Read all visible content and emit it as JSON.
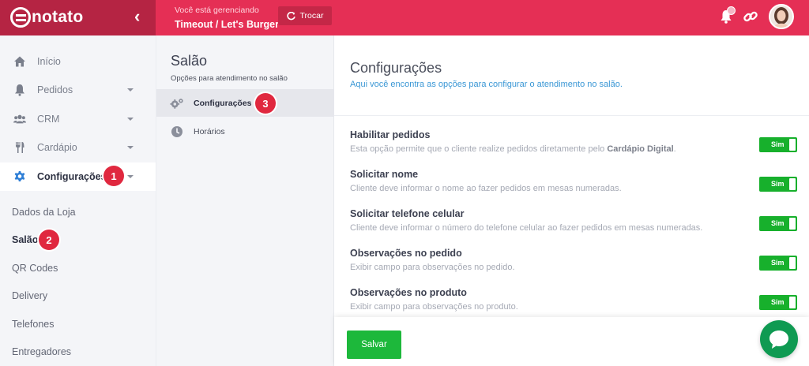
{
  "brand": {
    "name": "notato"
  },
  "topbar": {
    "managing_label": "Você está gerenciando",
    "store_name": "Timeout / Let's Burger",
    "swap_label": "Trocar",
    "notification_icon": "bell-icon",
    "link_icon": "link-icon"
  },
  "sidebar": {
    "items": [
      {
        "label": "Início",
        "icon": "home-icon"
      },
      {
        "label": "Pedidos",
        "icon": "bell-icon"
      },
      {
        "label": "CRM",
        "icon": "users-icon"
      },
      {
        "label": "Cardápio",
        "icon": "cutlery-icon"
      },
      {
        "label": "Configurações",
        "icon": "gear-icon"
      }
    ],
    "sub_items": [
      "Dados da Loja",
      "Salão",
      "QR Codes",
      "Delivery",
      "Telefones",
      "Entregadores"
    ],
    "steps": [
      "1",
      "2",
      "3"
    ]
  },
  "midpanel": {
    "title": "Salão",
    "subtitle": "Opções para atendimento no salão",
    "items": [
      {
        "label": "Configurações",
        "icon": "gears-icon"
      },
      {
        "label": "Horários",
        "icon": "clock-icon"
      }
    ]
  },
  "main": {
    "title": "Configurações",
    "description": "Aqui você encontra as opções para configurar o atendimento no salão.",
    "options": [
      {
        "title": "Habilitar pedidos",
        "desc_before": "Esta opção permite que o cliente realize pedidos diretamente pelo ",
        "desc_bold": "Cardápio Digital",
        "desc_after": ".",
        "toggle": "Sim"
      },
      {
        "title": "Solicitar nome",
        "desc": "Cliente deve informar o nome ao fazer pedidos em mesas numeradas.",
        "toggle": "Sim"
      },
      {
        "title": "Solicitar telefone celular",
        "desc": "Cliente deve informar o número do telefone celular ao fazer pedidos em mesas numeradas.",
        "toggle": "Sim"
      },
      {
        "title": "Observações no pedido",
        "desc": "Exibir campo para observações no pedido.",
        "toggle": "Sim"
      },
      {
        "title": "Observações no produto",
        "desc": "Exibir campo para observações no produto.",
        "toggle": "Sim"
      }
    ],
    "save_label": "Salvar"
  },
  "colors": {
    "brand": "#e52f55",
    "brand_dark": "#b52443",
    "toggle_on": "#17b02c",
    "save": "#1db83b",
    "link": "#3a97d5",
    "step_badge": "#e0283f",
    "chat": "#0f9a52"
  }
}
